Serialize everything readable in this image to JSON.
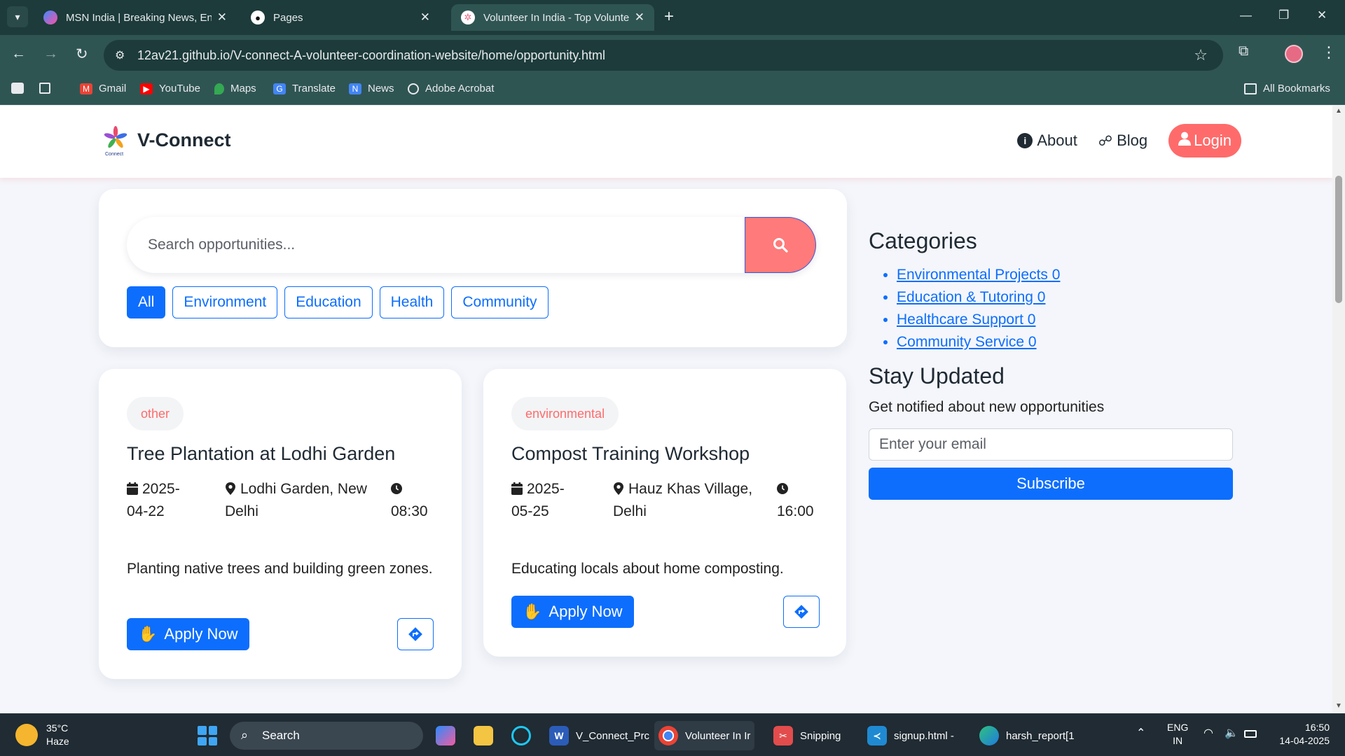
{
  "browser": {
    "tabs": [
      {
        "title": "MSN India | Breaking News, Ent",
        "active": false
      },
      {
        "title": "Pages",
        "active": false
      },
      {
        "title": "Volunteer In India - Top Volunte",
        "active": true
      }
    ],
    "url": "12av21.github.io/V-connect-A-volunteer-coordination-website/home/opportunity.html",
    "bookmarks": [
      "Gmail",
      "YouTube",
      "Maps",
      "Translate",
      "News",
      "Adobe Acrobat"
    ],
    "all_bookmarks": "All Bookmarks"
  },
  "site": {
    "brand": "V-Connect",
    "logo_caption": "Connect",
    "nav": {
      "about": "About",
      "blog": "Blog",
      "login": "Login"
    }
  },
  "search": {
    "placeholder": "Search opportunities...",
    "filters": [
      "All",
      "Environment",
      "Education",
      "Health",
      "Community"
    ],
    "active_filter": "All"
  },
  "opportunities": [
    {
      "tag": "other",
      "title": "Tree Plantation at Lodhi Garden",
      "date_line1": "2025-",
      "date_line2": "04-22",
      "location_line1": "Lodhi Garden, New",
      "location_line2": "Delhi",
      "time": "08:30",
      "description": "Planting native trees and building green zones.",
      "apply_label": "Apply Now"
    },
    {
      "tag": "environmental",
      "title": "Compost Training Workshop",
      "date_line1": "2025-",
      "date_line2": "05-25",
      "location_line1": "Hauz Khas Village,",
      "location_line2": "Delhi",
      "time": "16:00",
      "description": "Educating locals about home composting.",
      "apply_label": "Apply Now"
    }
  ],
  "sidebar": {
    "categories_title": "Categories",
    "categories": [
      "Environmental Projects 0",
      "Education & Tutoring 0",
      "Healthcare Support 0",
      "Community Service 0"
    ],
    "newsletter_title": "Stay Updated",
    "newsletter_sub": "Get notified about new opportunities",
    "email_placeholder": "Enter your email",
    "subscribe_label": "Subscribe"
  },
  "taskbar": {
    "weather_temp": "35°C",
    "weather_cond": "Haze",
    "search_label": "Search",
    "apps": [
      "V_Connect_Prc",
      "Volunteer In Ir",
      "Snipping",
      "signup.html -",
      "harsh_report[1"
    ],
    "lang_line1": "ENG",
    "lang_line2": "IN",
    "time": "16:50",
    "date": "14-04-2025"
  },
  "colors": {
    "primary": "#0d6efd",
    "accent": "#ff6b6b",
    "chrome": "#2f5553"
  }
}
